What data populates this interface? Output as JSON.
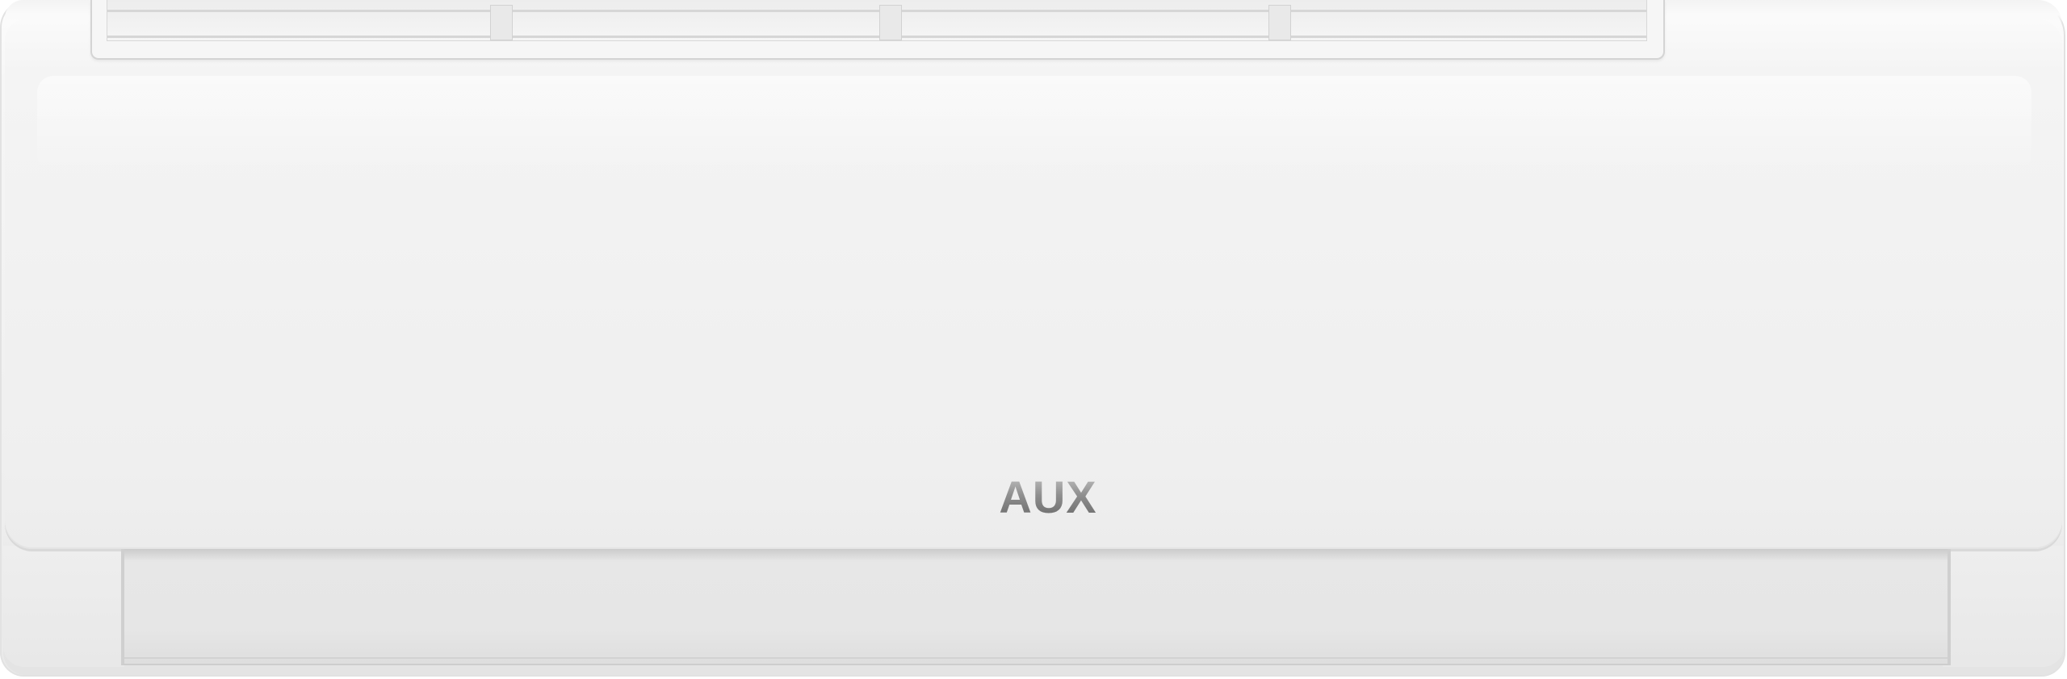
{
  "product": {
    "brand_logo": "AUX",
    "colors": {
      "body": "#f1f1f1",
      "logo": "#8e8e8e",
      "louver": "#e6e6e6"
    }
  }
}
